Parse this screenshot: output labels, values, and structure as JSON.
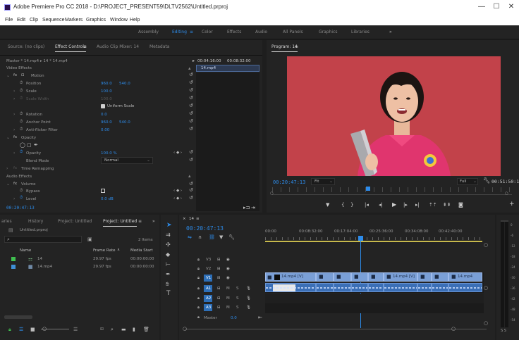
{
  "window": {
    "title": "Adobe Premiere Pro CC 2018 - D:\\PROJECT_PRESENT59\\DLTV2562\\Untitled.prproj",
    "minimize": "—",
    "maximize": "☐",
    "close": "✕"
  },
  "menu": [
    "File",
    "Edit",
    "Clip",
    "Sequence",
    "Markers",
    "Graphics",
    "Window",
    "Help"
  ],
  "workspaces": {
    "items": [
      "Assembly",
      "Editing",
      "Color",
      "Effects",
      "Audio",
      "All Panels",
      "Graphics",
      "Libraries"
    ],
    "active": "Editing",
    "more": "»"
  },
  "source_panel": {
    "tabs": [
      "Source: (no clips)",
      "Effect Controls",
      "Audio Clip Mixer: 14",
      "Metadata"
    ],
    "selected_tab": "Effect Controls",
    "header": "Master * 14.mp4  ▸  14 * 14.mp4",
    "ruler_times": [
      "00:04:16:00",
      "00:08:32:00"
    ],
    "clip_label": "14.mp4",
    "video_effects_label": "Video Effects",
    "motion": "Motion",
    "position_label": "Position",
    "position_x": "960.0",
    "position_y": "540.0",
    "scale_label": "Scale",
    "scale": "100.0",
    "scale_width_label": "Scale Width",
    "scale_width": "100.0",
    "uniform_scale": "Uniform Scale",
    "rotation_label": "Rotation",
    "rotation": "0.0",
    "anchor_label": "Anchor Point",
    "anchor_x": "960.0",
    "anchor_y": "540.0",
    "antiflicker_label": "Anti-flicker Filter",
    "antiflicker": "0.00",
    "opacity_group": "Opacity",
    "opacity_label": "Opacity",
    "opacity": "100.0 %",
    "blend_label": "Blend Mode",
    "blend": "Normal",
    "time_remap": "Time Remapping",
    "audio_effects_label": "Audio Effects",
    "volume": "Volume",
    "bypass_label": "Bypass",
    "level_label": "Level",
    "level": "0.0 dB",
    "timecode": "00:20:47:13"
  },
  "program_monitor": {
    "tab": "Program: 14",
    "timecode": "00:20:47:13",
    "fit": "Fit",
    "quality": "Full",
    "duration": "00:51:50:16"
  },
  "project_panel": {
    "tabs": [
      "aries",
      "History",
      "Project: Untitled",
      "Project: Untitled",
      "»"
    ],
    "selected_tab": "Project: Untitled",
    "project_file": "Untitled.prproj",
    "item_count": "2 Items",
    "col_name": "Name",
    "col_framerate": "Frame Rate",
    "col_mediastart": "Media Start",
    "items": [
      {
        "name": "14",
        "rate": "29.97 fps",
        "start": "00:00:00:00",
        "color": "#3fbf4f"
      },
      {
        "name": "14.mp4",
        "rate": "29.97 fps",
        "start": "00:00:00:00",
        "color": "#3f8fd6"
      }
    ]
  },
  "timeline": {
    "tab": "14",
    "timecode": "00:20:47:13",
    "ruler": [
      "00:00",
      "00:08:32:00",
      "00:17:04:00",
      "00:25:36:00",
      "00:34:08:00",
      "00:42:40:00"
    ],
    "video_tracks": [
      "V3",
      "V2",
      "V1"
    ],
    "audio_tracks": [
      "A1",
      "A2",
      "A3"
    ],
    "master": "Master",
    "master_val": "0.0",
    "clip_labels": [
      "14.mp4 [V]",
      "14.mp4 [V]",
      "14.mp4"
    ],
    "m": "M",
    "s": "S"
  },
  "meter_scale": [
    "0",
    "-6",
    "-12",
    "-18",
    "-24",
    "-30",
    "-36",
    "-42",
    "-48",
    "-54"
  ],
  "meter_bottom": "S S",
  "colors": {
    "accent": "#2d8ceb",
    "panel": "#232323",
    "background": "#1e1e1e",
    "video_bg": "#c2424a",
    "shirt": "#e0356e",
    "clip_video": "#7a9fd6",
    "clip_audio": "#3b6fb6"
  }
}
